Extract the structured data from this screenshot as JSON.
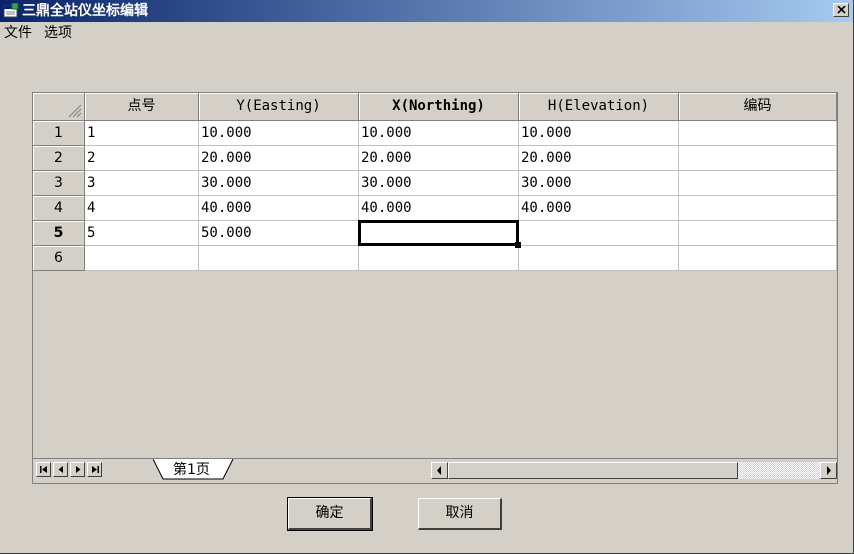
{
  "window": {
    "title": "三鼎全站仪坐标编辑"
  },
  "menu": {
    "file": "文件",
    "options": "选项"
  },
  "grid": {
    "columns": [
      "点号",
      "Y(Easting)",
      "X(Northing)",
      "H(Elevation)",
      "编码"
    ],
    "rows": [
      {
        "num": "1",
        "cells": [
          "1",
          "10.000",
          "10.000",
          "10.000",
          ""
        ]
      },
      {
        "num": "2",
        "cells": [
          "2",
          "20.000",
          "20.000",
          "20.000",
          ""
        ]
      },
      {
        "num": "3",
        "cells": [
          "3",
          "30.000",
          "30.000",
          "30.000",
          ""
        ]
      },
      {
        "num": "4",
        "cells": [
          "4",
          "40.000",
          "40.000",
          "40.000",
          ""
        ]
      },
      {
        "num": "5",
        "cells": [
          "5",
          "50.000",
          "",
          "",
          ""
        ]
      },
      {
        "num": "6",
        "cells": [
          "",
          "",
          "",
          "",
          ""
        ]
      }
    ],
    "active_row": "5",
    "active_column": "X(Northing)"
  },
  "sheet_tab": {
    "label": "第1页"
  },
  "buttons": {
    "ok": "确定",
    "cancel": "取消"
  }
}
